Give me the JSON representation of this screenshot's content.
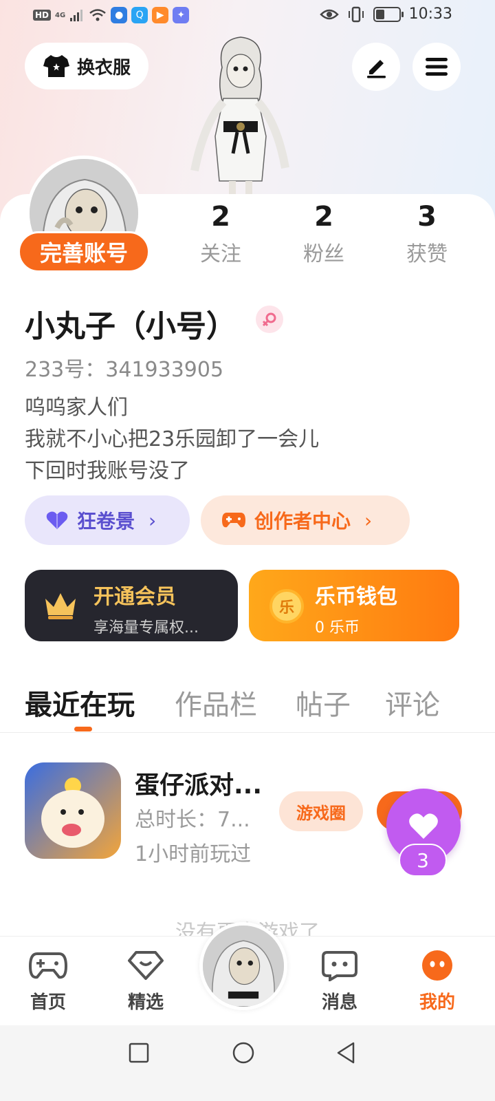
{
  "status_bar": {
    "hd": "HD",
    "network": "4G",
    "time": "10:33"
  },
  "header": {
    "dress_label": "换衣服"
  },
  "profile": {
    "complete_label": "完善账号",
    "stats": [
      {
        "value": "2",
        "label": "关注"
      },
      {
        "value": "2",
        "label": "粉丝"
      },
      {
        "value": "3",
        "label": "获赞"
      }
    ],
    "nickname": "小丸子（小号）",
    "uid": "233号：341933905",
    "bio": [
      "呜呜家人们",
      "我就不小心把23乐园卸了一会儿",
      "下回时我账号没了"
    ]
  },
  "chips": [
    {
      "label": "狂卷景",
      "arrow": "›"
    },
    {
      "label": "创作者中心",
      "arrow": "›"
    }
  ],
  "cards": {
    "vip": {
      "title": "开通会员",
      "subtitle": "享海量专属权..."
    },
    "wallet": {
      "title": "乐币钱包",
      "subtitle": "0 乐币",
      "coin_glyph": "乐"
    }
  },
  "tabs": [
    "最近在玩",
    "作品栏",
    "帖子",
    "评论"
  ],
  "recent_game": {
    "name": "蛋仔派对...",
    "total_time": "总时长：7...",
    "last_played": "1小时前玩过",
    "circle_label": "游戏圈",
    "likes": "3"
  },
  "list_footer": "没有更多游戏了",
  "bottom_nav": [
    "首页",
    "精选",
    "消息",
    "我的"
  ],
  "colors": {
    "accent": "#f7691b",
    "like_purple": "#c15bf0"
  }
}
